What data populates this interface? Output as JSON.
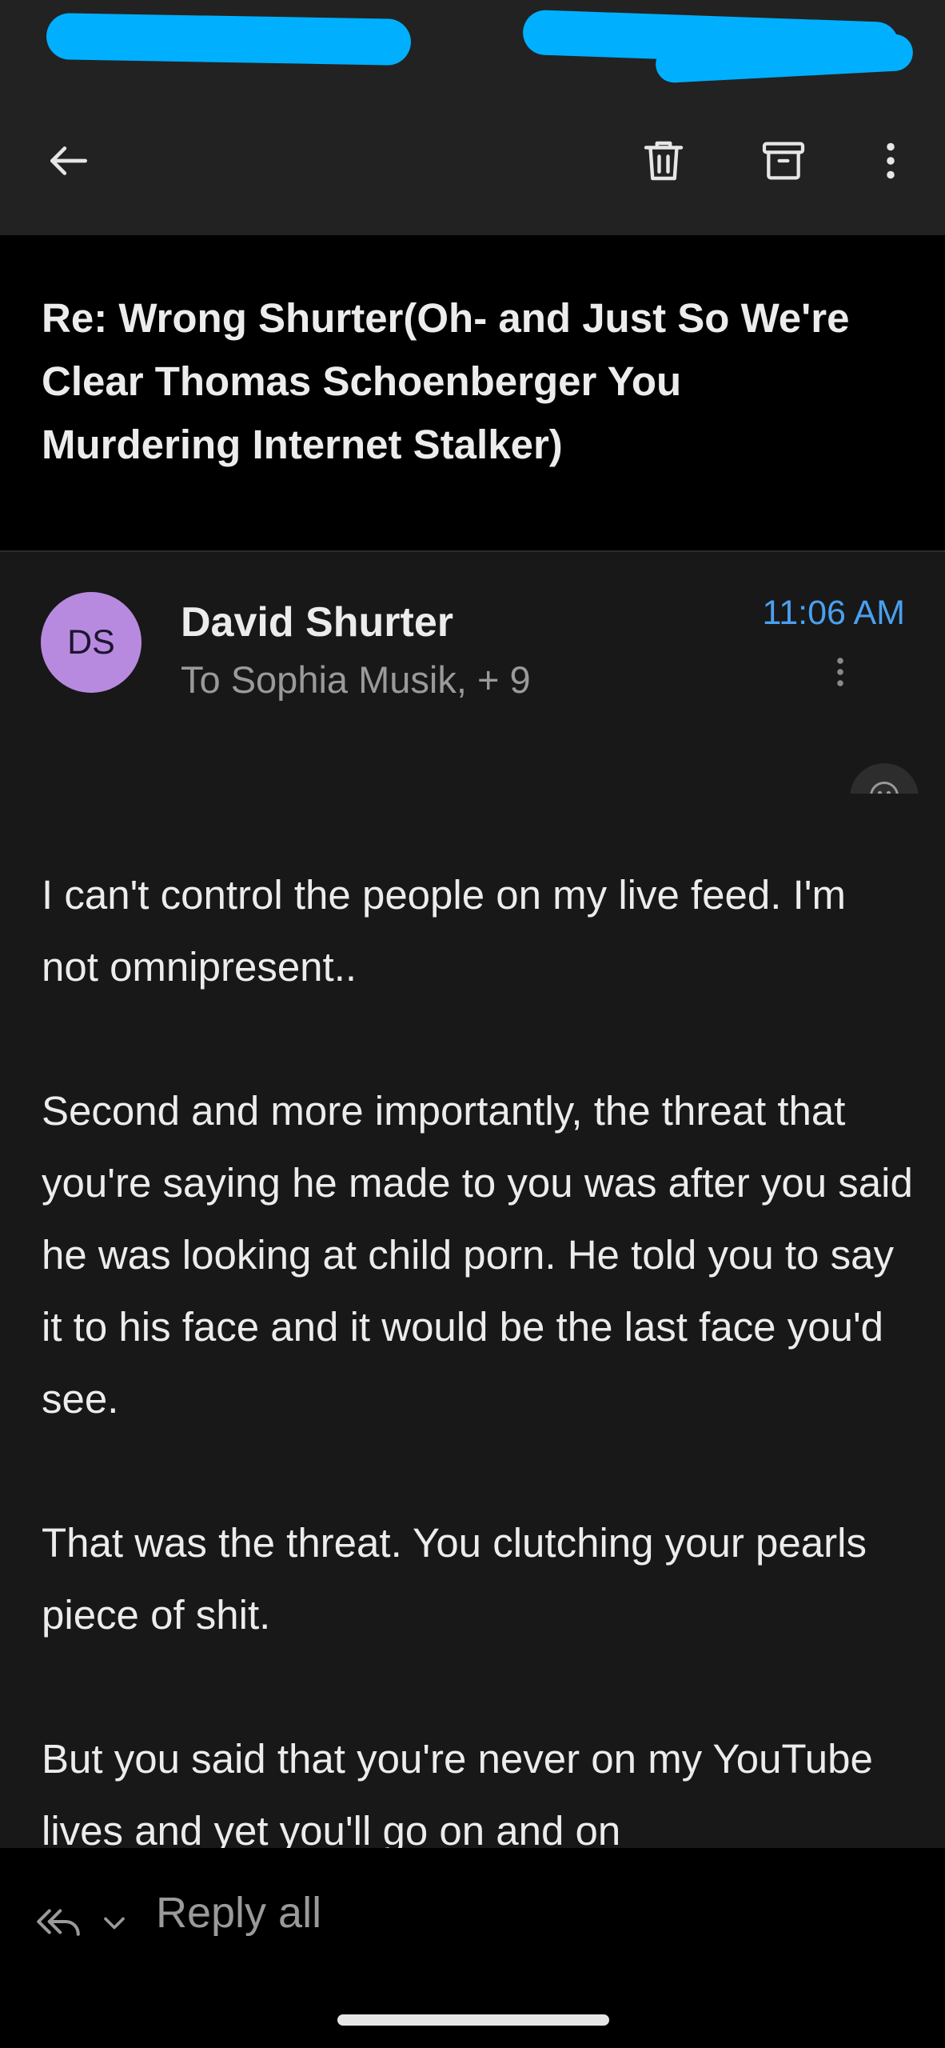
{
  "topbar": {
    "back_icon": "arrow-left-icon",
    "delete_icon": "trash-icon",
    "archive_icon": "archive-icon",
    "more_icon": "more-vertical-icon"
  },
  "email": {
    "subject": "Re: Wrong Shurter(Oh- and Just So We're Clear Thomas Schoenberger You Murdering Internet Stalker)",
    "avatar_initials": "DS",
    "avatar_color": "#b88adf",
    "sender": "David Shurter",
    "recipients": "To Sophia Musik, + 9",
    "time": "11:06 AM",
    "time_color": "#4aa0f0",
    "body": [
      "I can't control the people on my live feed. I'm not omnipresent..",
      "Second and more importantly, the threat that you're saying he made to you was after you said he was looking at child porn. He told you to say it to his face and it would be the last face you'd see.",
      "That was the threat. You clutching your pearls piece of shit.",
      "But you said that you're never on my YouTube lives and yet you'll go on and on"
    ]
  },
  "reply": {
    "label": "Reply all",
    "icon": "reply-all-icon",
    "chevron_icon": "chevron-down-icon"
  },
  "colors": {
    "redaction": "#00b0ff",
    "background": "#181818"
  }
}
